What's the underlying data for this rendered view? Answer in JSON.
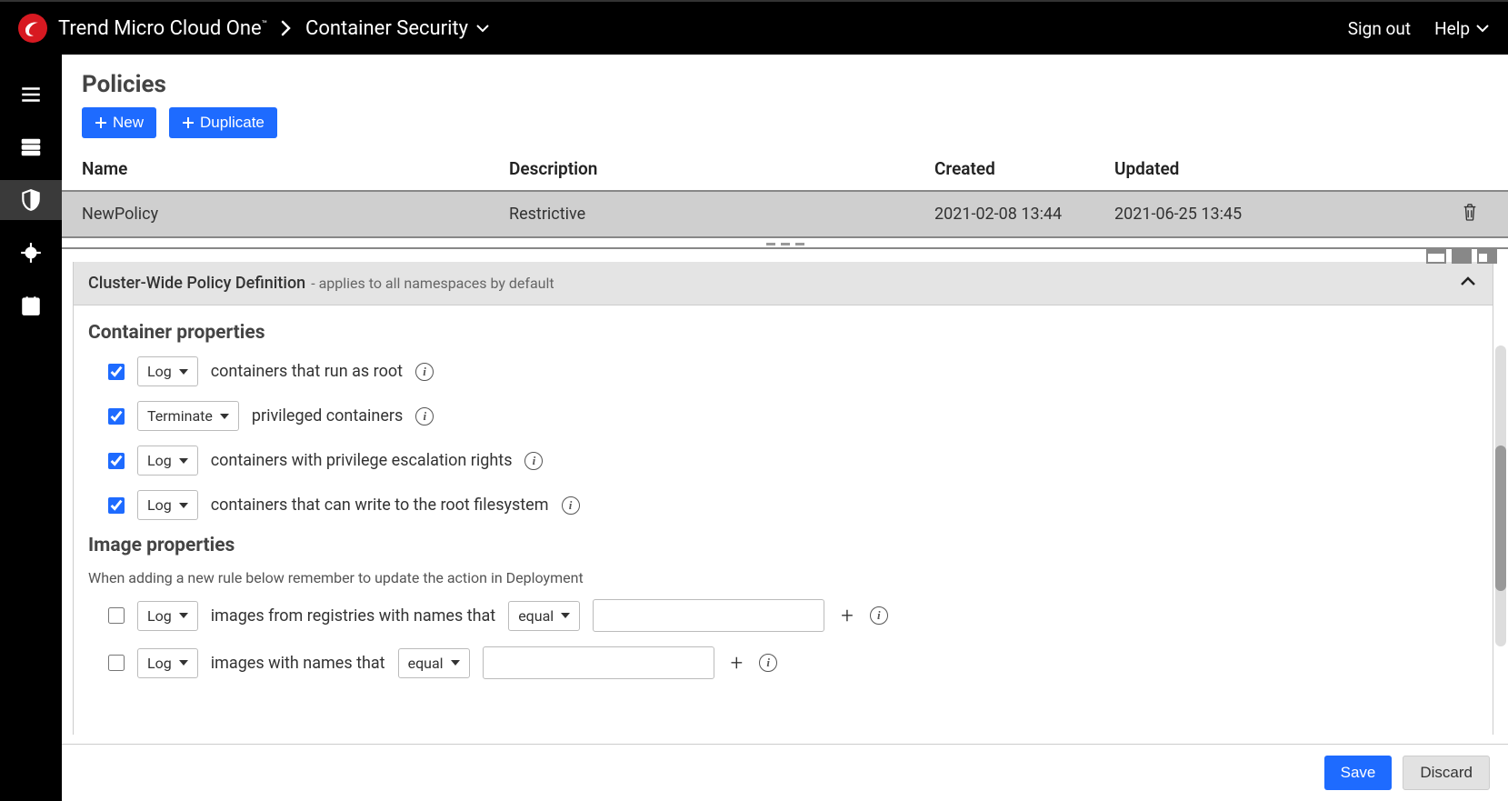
{
  "header": {
    "brand": "Trend Micro Cloud One",
    "brand_tm": "™",
    "section": "Container Security",
    "sign_out": "Sign out",
    "help": "Help"
  },
  "page": {
    "title": "Policies",
    "new_btn": "New",
    "duplicate_btn": "Duplicate"
  },
  "table": {
    "headers": {
      "name": "Name",
      "description": "Description",
      "created": "Created",
      "updated": "Updated"
    },
    "rows": [
      {
        "name": "NewPolicy",
        "description": "Restrictive",
        "created": "2021-02-08 13:44",
        "updated": "2021-06-25 13:45"
      }
    ]
  },
  "panel": {
    "title": "Cluster-Wide Policy Definition",
    "subtitle": "- applies to all namespaces by default"
  },
  "container_props": {
    "heading": "Container properties",
    "rules": [
      {
        "checked": true,
        "action": "Log",
        "text": "containers that run as root"
      },
      {
        "checked": true,
        "action": "Terminate",
        "text": "privileged containers"
      },
      {
        "checked": true,
        "action": "Log",
        "text": "containers with privilege escalation rights"
      },
      {
        "checked": true,
        "action": "Log",
        "text": "containers that can write to the root filesystem"
      }
    ]
  },
  "image_props": {
    "heading": "Image properties",
    "note": "When adding a new rule below remember to update the action in Deployment",
    "rules": [
      {
        "checked": false,
        "action": "Log",
        "text": "images from registries with names that",
        "match": "equal",
        "value": ""
      },
      {
        "checked": false,
        "action": "Log",
        "text": "images with names that",
        "match": "equal",
        "value": ""
      }
    ]
  },
  "footer": {
    "save": "Save",
    "discard": "Discard"
  }
}
